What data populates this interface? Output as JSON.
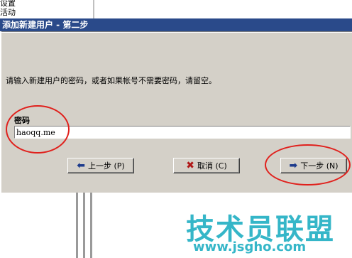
{
  "background": {
    "items": [
      "设置",
      "活动"
    ]
  },
  "dialog": {
    "title": "添加新建用户 - 第二步",
    "instruction": "请输入新建用户的密码，或者如果帐号不需要密码，请留空。",
    "password_label": "密码",
    "password_value": "haoqq.me",
    "buttons": {
      "prev": "上一步 (P)",
      "cancel": "取消 (C)",
      "next": "下一步 (N)"
    }
  },
  "icons": {
    "prev": "arrow-left-icon",
    "cancel": "red-x-icon",
    "next": "arrow-right-icon"
  },
  "colors": {
    "titlebar": "#2a4a8a",
    "panel": "#d4d0c8",
    "annotation": "#e0201c",
    "watermark": "#35b6c8"
  },
  "watermark": {
    "text": "技术员联盟",
    "url": "www.jsgho.com"
  }
}
